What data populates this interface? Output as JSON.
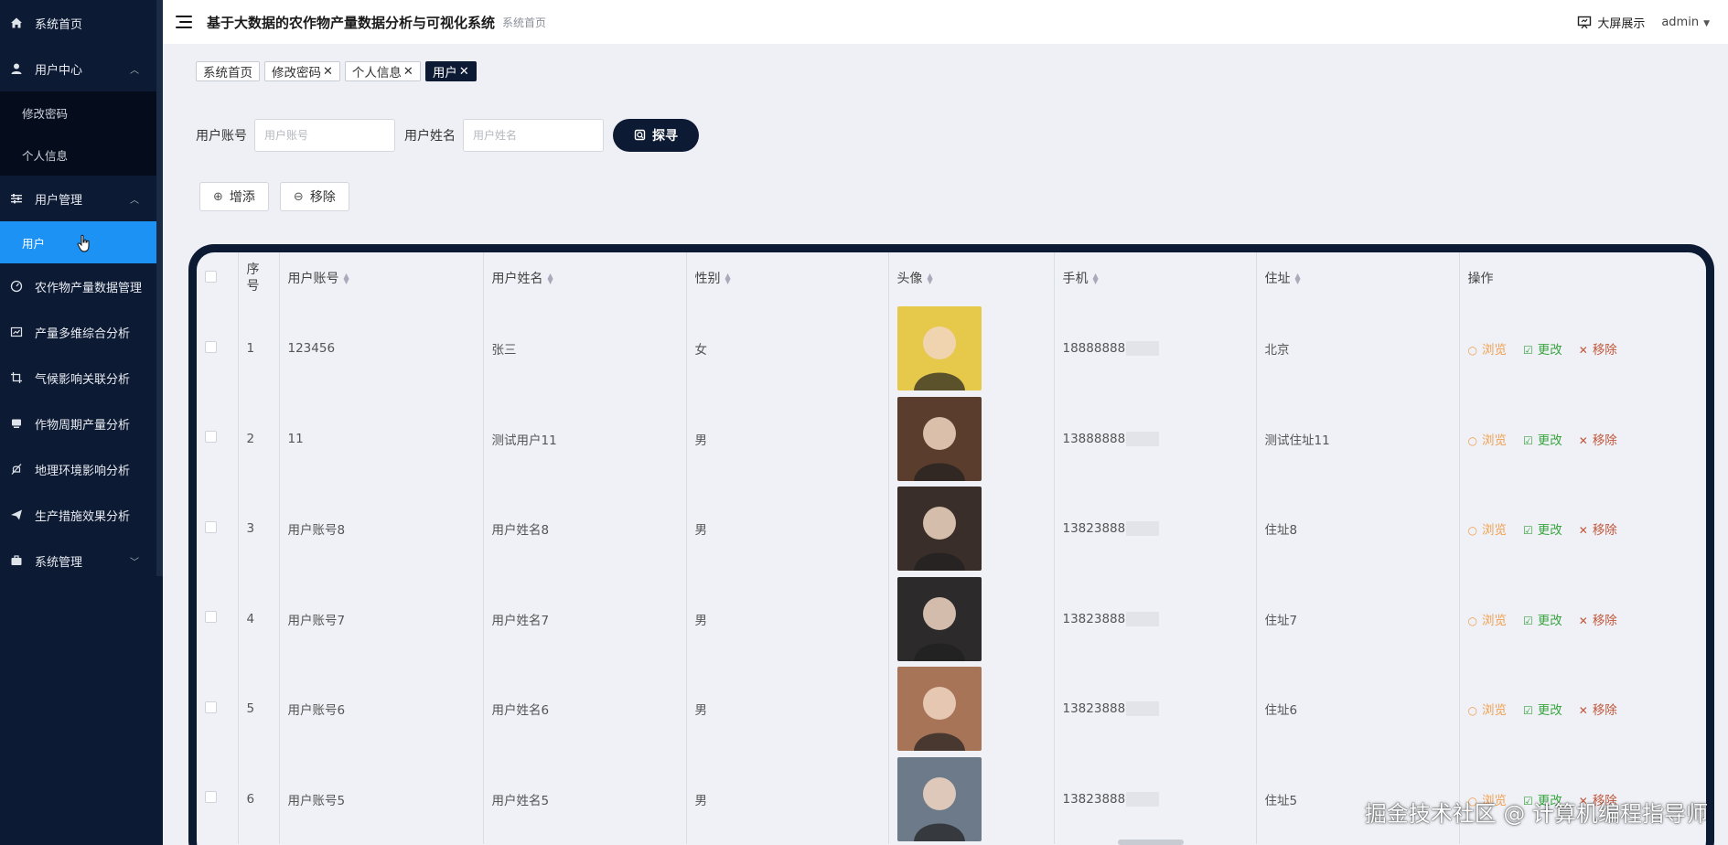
{
  "sidebar": {
    "items": [
      {
        "label": "系统首页",
        "icon": "home-icon"
      },
      {
        "label": "用户中心",
        "icon": "user-icon",
        "chevron": "︿",
        "children": [
          {
            "label": "修改密码"
          },
          {
            "label": "个人信息"
          }
        ]
      },
      {
        "label": "用户管理",
        "icon": "sliders-icon",
        "chevron": "︿",
        "children": [
          {
            "label": "用户",
            "active": true
          }
        ]
      },
      {
        "label": "农作物产量数据管理",
        "icon": "gauge-icon"
      },
      {
        "label": "产量多维综合分析",
        "icon": "chart-icon"
      },
      {
        "label": "气候影响关联分析",
        "icon": "crop-icon"
      },
      {
        "label": "作物周期产量分析",
        "icon": "monitor-icon"
      },
      {
        "label": "地理环境影响分析",
        "icon": "bell-off-icon"
      },
      {
        "label": "生产措施效果分析",
        "icon": "send-icon"
      },
      {
        "label": "系统管理",
        "icon": "briefcase-icon",
        "chevron": "﹀"
      }
    ]
  },
  "header": {
    "title": "基于大数据的农作物产量数据分析与可视化系统",
    "breadcrumb": "系统首页",
    "screen_label": "大屏展示",
    "user": "admin"
  },
  "tabs": [
    {
      "label": "系统首页",
      "closable": false
    },
    {
      "label": "修改密码",
      "closable": true
    },
    {
      "label": "个人信息",
      "closable": true
    },
    {
      "label": "用户",
      "closable": true,
      "active": true
    }
  ],
  "search": {
    "account_label": "用户账号",
    "account_placeholder": "用户账号",
    "name_label": "用户姓名",
    "name_placeholder": "用户姓名",
    "button": "探寻"
  },
  "actions": {
    "add": "增添",
    "remove": "移除"
  },
  "table": {
    "headers": {
      "index": "序号",
      "account": "用户账号",
      "name": "用户姓名",
      "gender": "性别",
      "avatar": "头像",
      "phone": "手机",
      "address": "住址",
      "ops": "操作"
    },
    "ops": {
      "view": "浏览",
      "edit": "更改",
      "delete": "移除"
    },
    "rows": [
      {
        "index": "1",
        "account": "123456",
        "name": "张三",
        "gender": "女",
        "phone": "18888888",
        "address": "北京",
        "avatar_color": "#e6c84a"
      },
      {
        "index": "2",
        "account": "11",
        "name": "测试用户11",
        "gender": "男",
        "phone": "13888888",
        "address": "测试住址11",
        "avatar_color": "#5a3d2c"
      },
      {
        "index": "3",
        "account": "用户账号8",
        "name": "用户姓名8",
        "gender": "男",
        "phone": "13823888",
        "address": "住址8",
        "avatar_color": "#3a2e2a"
      },
      {
        "index": "4",
        "account": "用户账号7",
        "name": "用户姓名7",
        "gender": "男",
        "phone": "13823888",
        "address": "住址7",
        "avatar_color": "#2c2a2b"
      },
      {
        "index": "5",
        "account": "用户账号6",
        "name": "用户姓名6",
        "gender": "男",
        "phone": "13823888",
        "address": "住址6",
        "avatar_color": "#a87458"
      },
      {
        "index": "6",
        "account": "用户账号5",
        "name": "用户姓名5",
        "gender": "男",
        "phone": "13823888",
        "address": "住址5",
        "avatar_color": "#6d7a8a"
      }
    ]
  },
  "watermark": "掘金技术社区 @ 计算机编程指导师"
}
